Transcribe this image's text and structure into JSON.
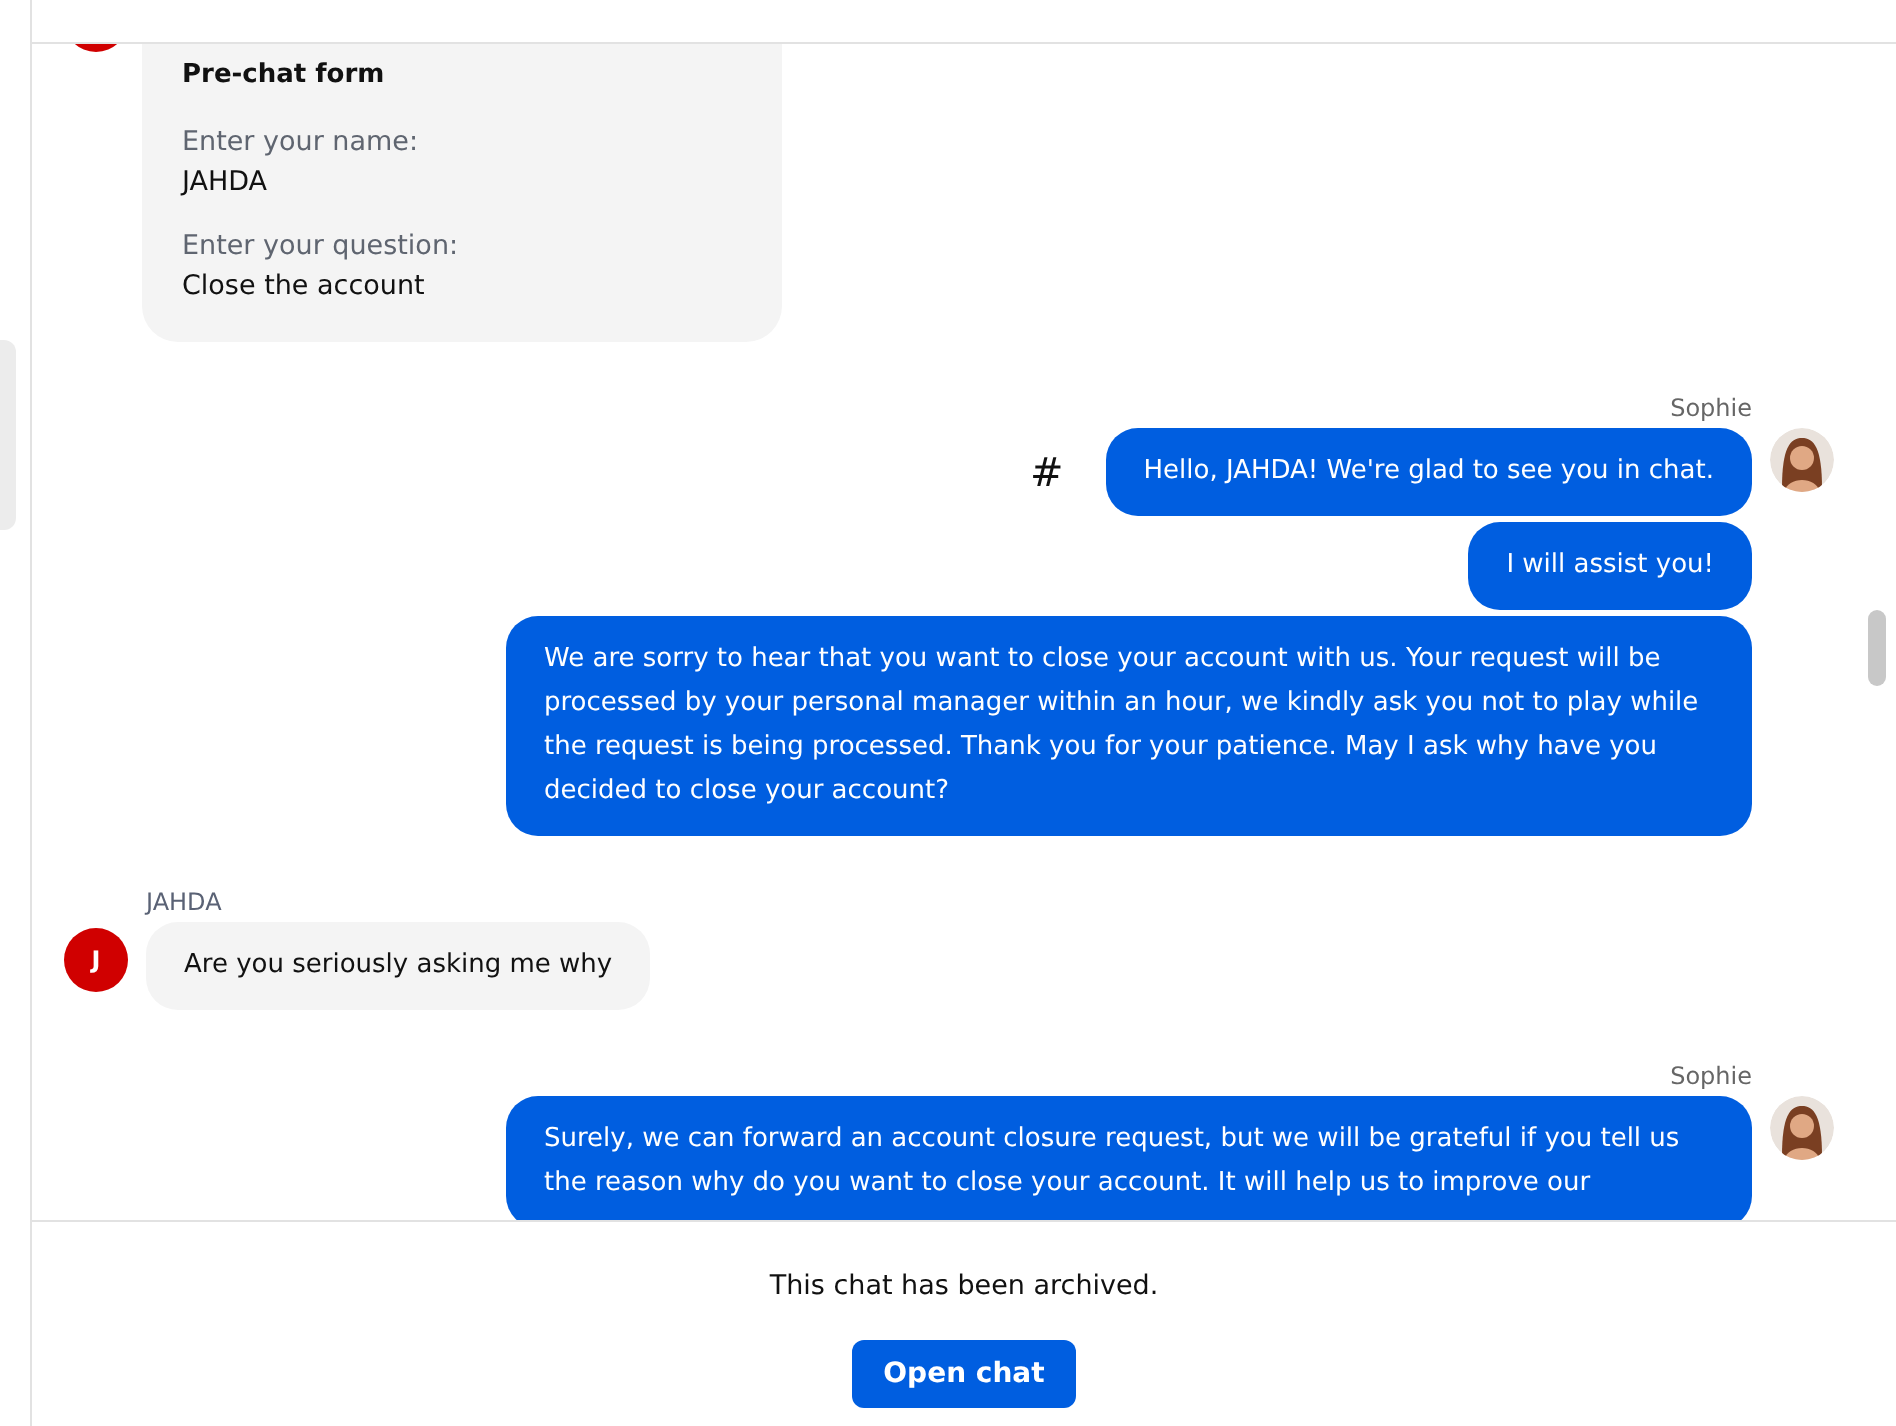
{
  "messages": [
    {
      "kind": "form",
      "title": "Pre-chat form",
      "fields": [
        {
          "label": "Enter your name:",
          "value": "JAHDA"
        },
        {
          "label": "Enter your question:",
          "value": "Close the account"
        }
      ]
    },
    {
      "kind": "agent",
      "author": "Sophie",
      "bubbles": [
        {
          "text": "Hello, JAHDA! We're glad to see you in chat.",
          "marker": "#"
        },
        {
          "text": "I will assist you!"
        },
        {
          "text": "We are sorry to hear that you want to close your account with us. Your request will be processed by your personal manager within an hour, we kindly ask you not to play while the request is being processed. Thank you for your patience. May I ask why have you decided to close your account?"
        }
      ]
    },
    {
      "kind": "visitor",
      "author": "JAHDA",
      "initial": "J",
      "bubbles": [
        {
          "text": "Are you seriously asking me why"
        }
      ]
    },
    {
      "kind": "agent",
      "author": "Sophie",
      "bubbles": [
        {
          "text": "Surely, we can forward an account closure request, but we will be grateful if you tell us the reason why do you want to close your account. It will help us to improve our"
        }
      ]
    }
  ],
  "footer": {
    "notice": "This chat has been archived.",
    "button": "Open chat"
  }
}
